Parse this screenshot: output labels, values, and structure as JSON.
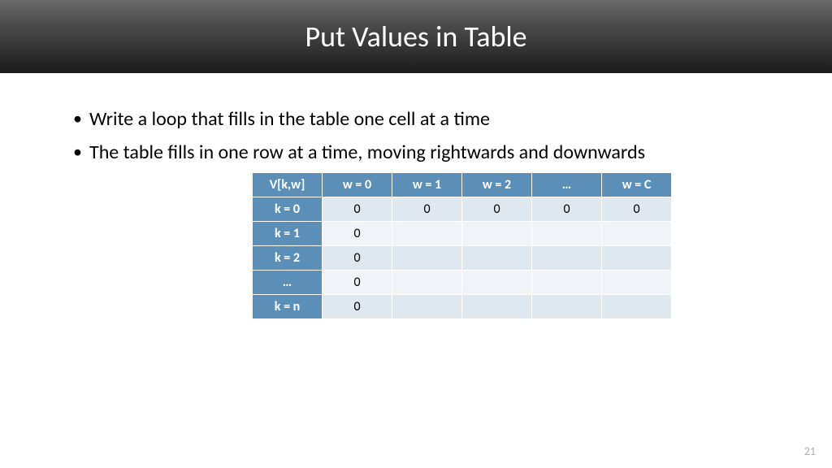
{
  "header": {
    "title": "Put Values in Table"
  },
  "bullets": {
    "items": [
      "Write a loop that fills in the table one cell at a time",
      "The table fills in one row at a time, moving rightwards and downwards"
    ]
  },
  "table": {
    "columns": [
      "V[k,w]",
      "w = 0",
      "w = 1",
      "w = 2",
      "…",
      "w = C"
    ],
    "rows": [
      {
        "header": "k = 0",
        "cells": [
          "0",
          "0",
          "0",
          "0",
          "0"
        ]
      },
      {
        "header": "k = 1",
        "cells": [
          "0",
          "",
          "",
          "",
          ""
        ]
      },
      {
        "header": "k = 2",
        "cells": [
          "0",
          "",
          "",
          "",
          ""
        ]
      },
      {
        "header": "…",
        "cells": [
          "0",
          "",
          "",
          "",
          ""
        ]
      },
      {
        "header": "k = n",
        "cells": [
          "0",
          "",
          "",
          "",
          ""
        ]
      }
    ]
  },
  "page_number": "21"
}
